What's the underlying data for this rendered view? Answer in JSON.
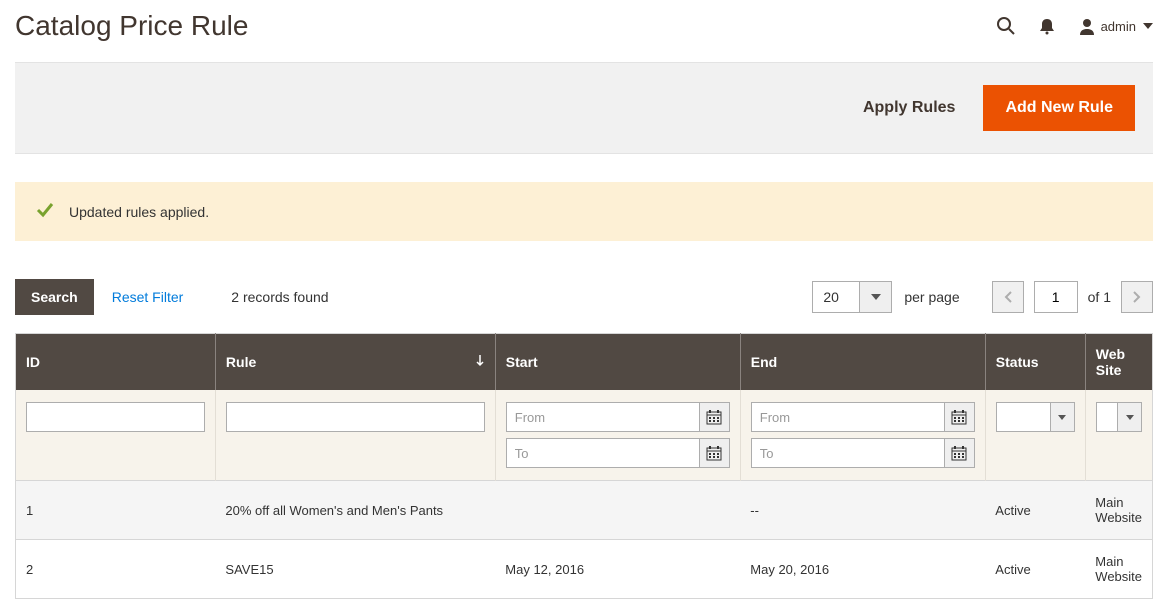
{
  "header": {
    "title": "Catalog Price Rule",
    "user_label": "admin"
  },
  "actions": {
    "apply_rules": "Apply Rules",
    "add_new": "Add New Rule"
  },
  "message": {
    "text": "Updated rules applied."
  },
  "controls": {
    "search_label": "Search",
    "reset_label": "Reset Filter",
    "records_found": "2 records found",
    "per_page_value": "20",
    "per_page_label": "per page",
    "page_value": "1",
    "page_of": "of 1"
  },
  "columns": {
    "id": "ID",
    "rule": "Rule",
    "start": "Start",
    "end": "End",
    "status": "Status",
    "website": "Web Site"
  },
  "filters": {
    "from_placeholder": "From",
    "to_placeholder": "To"
  },
  "rows": [
    {
      "id": "1",
      "rule": "20% off all Women's and Men's Pants",
      "start": "",
      "end": "--",
      "status": "Active",
      "website": "Main Website"
    },
    {
      "id": "2",
      "rule": "SAVE15",
      "start": "May 12, 2016",
      "end": "May 20, 2016",
      "status": "Active",
      "website": "Main Website"
    }
  ]
}
